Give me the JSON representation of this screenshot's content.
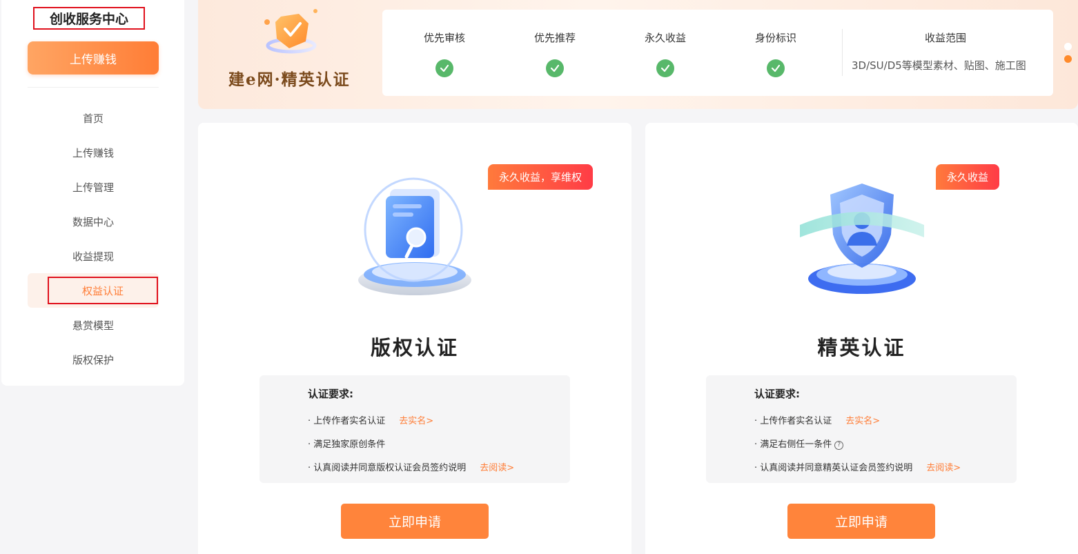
{
  "sidebar": {
    "title": "创收服务中心",
    "upload_button": "上传赚钱",
    "nav": [
      {
        "label": "首页",
        "active": false
      },
      {
        "label": "上传赚钱",
        "active": false
      },
      {
        "label": "上传管理",
        "active": false
      },
      {
        "label": "数据中心",
        "active": false
      },
      {
        "label": "收益提现",
        "active": false
      },
      {
        "label": "权益认证",
        "active": true
      },
      {
        "label": "悬赏模型",
        "active": false
      },
      {
        "label": "版权保护",
        "active": false
      }
    ]
  },
  "banner": {
    "logo_text": "建e网·精英认证",
    "benefits": [
      "优先审核",
      "优先推荐",
      "永久收益",
      "身份标识"
    ],
    "scope_title": "收益范围",
    "scope_text": "3D/SU/D5等模型素材、贴图、施工图",
    "carousel_dots": 2,
    "carousel_active": 1
  },
  "cards": [
    {
      "tag": "永久收益，享维权",
      "title": "版权认证",
      "requirements_title": "认证要求:",
      "requirements": [
        {
          "text": "· 上传作者实名认证",
          "link": "去实名>"
        },
        {
          "text": "· 满足独家原创条件",
          "link": ""
        },
        {
          "text": "· 认真阅读并同意版权认证会员签约说明",
          "link": "去阅读>"
        }
      ],
      "apply_button": "立即申请"
    },
    {
      "tag": "永久收益",
      "title": "精英认证",
      "requirements_title": "认证要求:",
      "requirements": [
        {
          "text": "· 上传作者实名认证",
          "link": "去实名>"
        },
        {
          "text": "· 满足右侧任一条件",
          "link": "",
          "help": "?"
        },
        {
          "text": "· 认真阅读并同意精英认证会员签约说明",
          "link": "去阅读>"
        }
      ],
      "apply_button": "立即申请"
    }
  ],
  "colors": {
    "accent": "#ff7d36",
    "check": "#58b86a",
    "tag_start": "#ff7a3c",
    "tag_end": "#ff3c46",
    "highlight_border": "#e0101c"
  }
}
